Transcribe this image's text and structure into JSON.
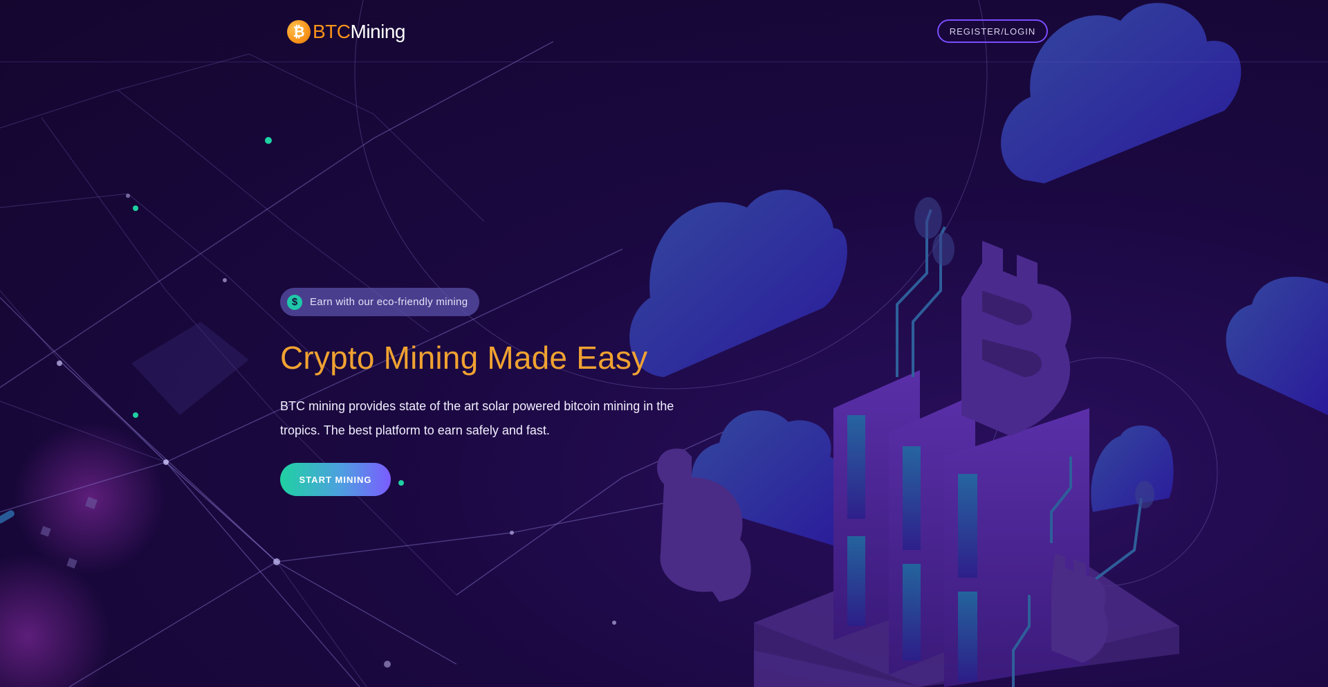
{
  "header": {
    "logo_part1": "BTC",
    "logo_part2": "Mining",
    "logo_coin_symbol": "₿",
    "register_label": "REGISTER/LOGIN"
  },
  "hero": {
    "badge_icon_symbol": "$",
    "badge_text": "Earn with our eco-friendly mining",
    "title": "Crypto Mining Made Easy",
    "description": "BTC mining provides state of the art solar powered bitcoin mining in the tropics. The best platform to earn safely and fast.",
    "cta_label": "START MINING"
  },
  "colors": {
    "background": "#1a0840",
    "accent_orange": "#f7931a",
    "title_orange": "#f0a231",
    "accent_teal": "#1fc8a9",
    "accent_purple": "#7b4dff",
    "cloud_blue": "#2a3aa8",
    "tower_purple": "#4b2a8e"
  },
  "icons": {
    "logo": "bitcoin-coin-icon",
    "badge": "dollar-icon"
  }
}
